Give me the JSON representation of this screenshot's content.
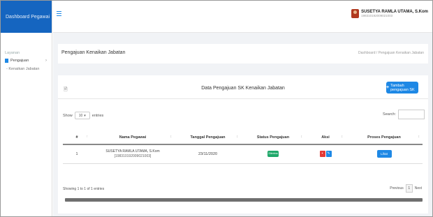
{
  "sidebar": {
    "brand": "Dashboard Pegawai",
    "section_label": "Layanan",
    "menu_item": "Pengajuan",
    "sub_item": "Kenaikan Jabatan"
  },
  "header": {
    "user_name": "SUSETYA RAMLA UTAMA, S.Kom",
    "user_nip": "198310192009021003"
  },
  "page": {
    "title": "Pengajuan Kenaikan Jabatan",
    "breadcrumb": "Dashboard / Pengajuan Kenaikan Jabatan"
  },
  "card": {
    "title": "Data Pengajuan SK Kenaikan Jabatan",
    "add_button": "Tambah pengajuan SK"
  },
  "table_controls": {
    "show_label": "Show",
    "entries_value": "10",
    "entries_label": "entries",
    "search_label": "Search:",
    "search_value": ""
  },
  "table": {
    "columns": [
      "#",
      "Nama Pegawai",
      "Tanggal Pengajuan",
      "Status Pengajuan",
      "Aksi",
      "Proses Pengajuan"
    ],
    "rows": [
      {
        "no": "1",
        "name": "SUSETYA RAMLA UTAMA, S.Kom",
        "nip": "[198310192009021003]",
        "date": "23/11/2020",
        "status": "Diterima",
        "process": "Lihat"
      }
    ]
  },
  "footer": {
    "info": "Showing 1 to 1 of 1 entries",
    "previous": "Previous",
    "page": "1",
    "next": "Next"
  }
}
